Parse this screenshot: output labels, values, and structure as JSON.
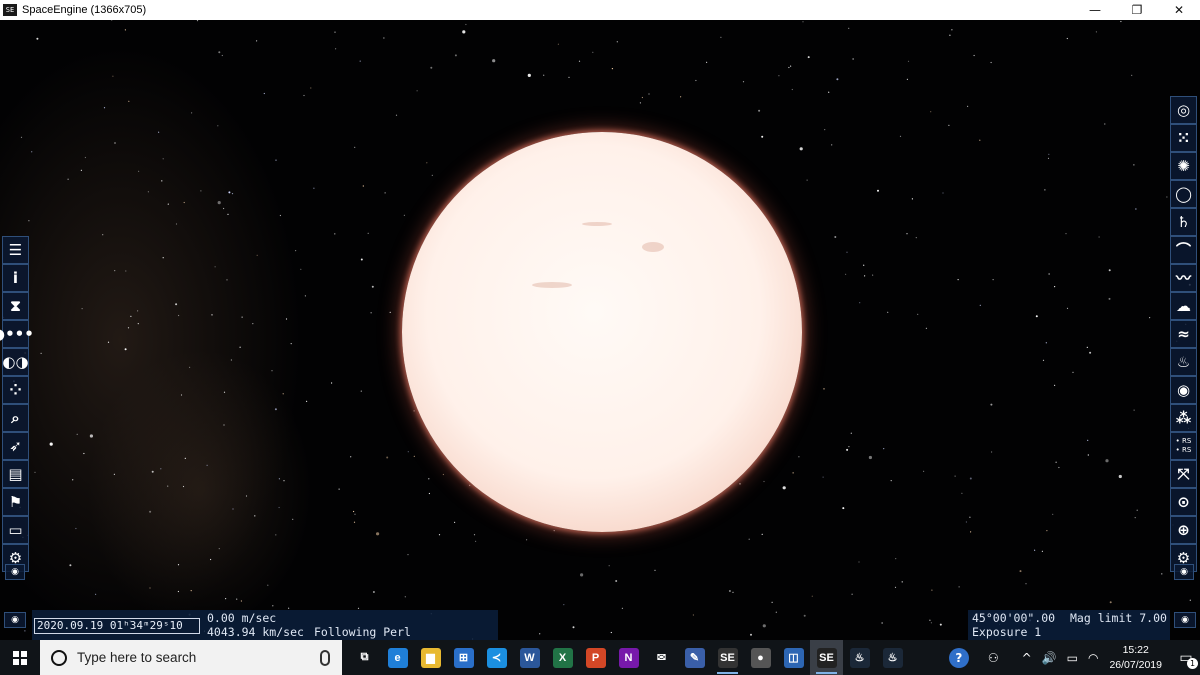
{
  "window": {
    "title": "SpaceEngine (1366x705)",
    "app_icon": "spaceengine-logo-icon",
    "controls": {
      "minimize": "—",
      "maximize": "❐",
      "close": "✕"
    }
  },
  "left_toolbar": [
    {
      "name": "menu-icon",
      "glyph": "☰"
    },
    {
      "name": "info-icon",
      "glyph": "i"
    },
    {
      "name": "time-panel-icon",
      "glyph": "⧗"
    },
    {
      "name": "planetary-system-icon",
      "glyph": "◗•••"
    },
    {
      "name": "tour-icon",
      "glyph": "◐◑"
    },
    {
      "name": "star-browser-icon",
      "glyph": "⁘"
    },
    {
      "name": "search-icon",
      "glyph": "⌕"
    },
    {
      "name": "ship-icon",
      "glyph": "➶"
    },
    {
      "name": "scenario-icon",
      "glyph": "▤"
    },
    {
      "name": "bookmarks-flag-icon",
      "glyph": "⚑"
    },
    {
      "name": "display-icon",
      "glyph": "▭"
    },
    {
      "name": "settings-gear-icon",
      "glyph": "⚙"
    }
  ],
  "right_toolbar": [
    {
      "name": "galaxies-filter-icon",
      "glyph": "◎"
    },
    {
      "name": "star-clusters-filter-icon",
      "glyph": "⁙"
    },
    {
      "name": "nebulae-filter-icon",
      "glyph": "✺"
    },
    {
      "name": "stars-filter-icon",
      "glyph": "◯"
    },
    {
      "name": "planets-filter-icon",
      "glyph": "♄"
    },
    {
      "name": "orbits-filter-icon",
      "glyph": "⌒"
    },
    {
      "name": "trajectory-filter-icon",
      "glyph": "〰"
    },
    {
      "name": "atmosphere-filter-icon",
      "glyph": "☁"
    },
    {
      "name": "water-filter-icon",
      "glyph": "≈"
    },
    {
      "name": "aurora-filter-icon",
      "glyph": "♨"
    },
    {
      "name": "eye-filter-icon",
      "glyph": "◉"
    },
    {
      "name": "constellations-filter-icon",
      "glyph": "⁂"
    },
    {
      "name": "rs-labels-filter-icon",
      "glyph": "• RS\n• RS"
    },
    {
      "name": "expand-arrows-icon",
      "glyph": "⤧"
    },
    {
      "name": "target-circle-icon",
      "glyph": "⊙"
    },
    {
      "name": "grid-globe-icon",
      "glyph": "⊕"
    },
    {
      "name": "settings-gear-icon",
      "glyph": "⚙"
    }
  ],
  "hud": {
    "date_time": "2020.09.19  01ʰ34ᵐ29ˢ10",
    "speed": "0.00  m/sec",
    "velocity": "4043.94  km/sec",
    "status": "Following  Perl",
    "fov": "45°00'00\".00",
    "exposure": "Exposure  1",
    "mag_limit": "Mag  limit  7.00"
  },
  "taskbar": {
    "search_placeholder": "Type here to search",
    "apps": [
      {
        "name": "task-view-icon",
        "glyph": "⧉",
        "color": "#101418"
      },
      {
        "name": "edge-icon",
        "glyph": "e",
        "color": "#1f7fd8"
      },
      {
        "name": "file-explorer-icon",
        "glyph": "▆",
        "color": "#e8b931"
      },
      {
        "name": "store-icon",
        "glyph": "⊞",
        "color": "#2a6fc9"
      },
      {
        "name": "visual-studio-code-icon",
        "glyph": "≺",
        "color": "#1b8fe0"
      },
      {
        "name": "word-icon",
        "glyph": "W",
        "color": "#2b579a"
      },
      {
        "name": "excel-icon",
        "glyph": "X",
        "color": "#217346"
      },
      {
        "name": "powerpoint-icon",
        "glyph": "P",
        "color": "#d24726"
      },
      {
        "name": "onenote-icon",
        "glyph": "N",
        "color": "#7719aa"
      },
      {
        "name": "mail-icon",
        "glyph": "✉",
        "color": "#101418"
      },
      {
        "name": "pen-app-icon",
        "glyph": "✎",
        "color": "#3a5fa8"
      },
      {
        "name": "spaceengine-taskbar-icon",
        "glyph": "SE",
        "color": "#333"
      },
      {
        "name": "moon-app-icon",
        "glyph": "●",
        "color": "#555"
      },
      {
        "name": "camera-app-icon",
        "glyph": "◫",
        "color": "#2d66b3"
      },
      {
        "name": "spaceengine-active-icon",
        "glyph": "SE",
        "color": "#222"
      },
      {
        "name": "steam-icon",
        "glyph": "♨",
        "color": "#1b2838"
      },
      {
        "name": "steam-alt-icon",
        "glyph": "♨",
        "color": "#1b2838"
      }
    ],
    "tray": {
      "help": "?",
      "people": "⚇",
      "chevron": "^",
      "volume": "🔊",
      "battery": "▭",
      "wifi": "◠",
      "time": "15:22",
      "date": "26/07/2019",
      "notification_count": "1"
    }
  }
}
